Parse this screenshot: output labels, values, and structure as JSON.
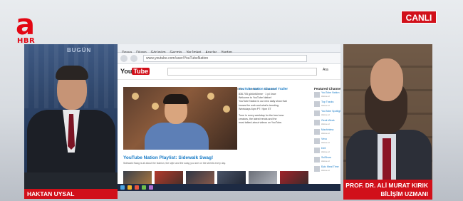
{
  "channel": {
    "logo_letter": "a",
    "logo_sub": "HBR",
    "live_label": "CANLI"
  },
  "studio_text": "BUGÜN",
  "host": {
    "name": "HAKTAN UYSAL"
  },
  "guest": {
    "name": "PROF. DR. ALİ MURAT KIRIK",
    "title": "BİLİŞİM UZMANI"
  },
  "screen": {
    "menu": [
      "Dosya",
      "Düzen",
      "Görünüm",
      "Geçmiş",
      "Yer İmleri",
      "Araçlar",
      "Yardım"
    ],
    "address": "www.youtube.com/user/YouTubeNation",
    "youtube_logo_left": "You",
    "youtube_logo_right": "Tube",
    "search_button": "Ara",
    "tabs": [
      "YouTube Nation",
      "Videolar",
      "Oynatma listeleri",
      "Kanallar",
      "Hakkında"
    ],
    "info_title": "YouTube Nation Channel Trailer",
    "info_lines": [
      "836.705 görüntüleme · 1 yıl önce",
      "Welcome to YouTube Nation!",
      "YouTube Nation is our new daily show that",
      "knows the web and what's trending.",
      "Weekdays 6pm PT / 9pm ET",
      "",
      "Tune in every weekday for the best new",
      "creators, the latest trends and the",
      "most talked-about videos on YouTube."
    ],
    "playlist_heading": "YouTube Nation Playlist: Sidewalk Swag!",
    "playlist_desc": "Sidewalk Swag is all about the fashion, the style and the swag you see on the streets every day.",
    "featured_title": "Featured Channels",
    "featured_channels": [
      {
        "name": "YouTube Nation",
        "sub": "Abone ol"
      },
      {
        "name": "Top Tracks",
        "sub": "Abone ol"
      },
      {
        "name": "YouTube Spotlight",
        "sub": "Abone ol"
      },
      {
        "name": "Geek Week",
        "sub": "Abone ol"
      },
      {
        "name": "Machinima",
        "sub": "Abone ol"
      },
      {
        "name": "Vevo",
        "sub": "Abone ol"
      },
      {
        "name": "Dell",
        "sub": "Abone ol"
      },
      {
        "name": "SciShow",
        "sub": "Abone ol"
      },
      {
        "name": "Epic Meal Time",
        "sub": "Abone ol"
      }
    ]
  },
  "colors": {
    "brand_red": "#d1101a",
    "link_blue": "#167ac6",
    "taskbar": "#1d2a43"
  }
}
